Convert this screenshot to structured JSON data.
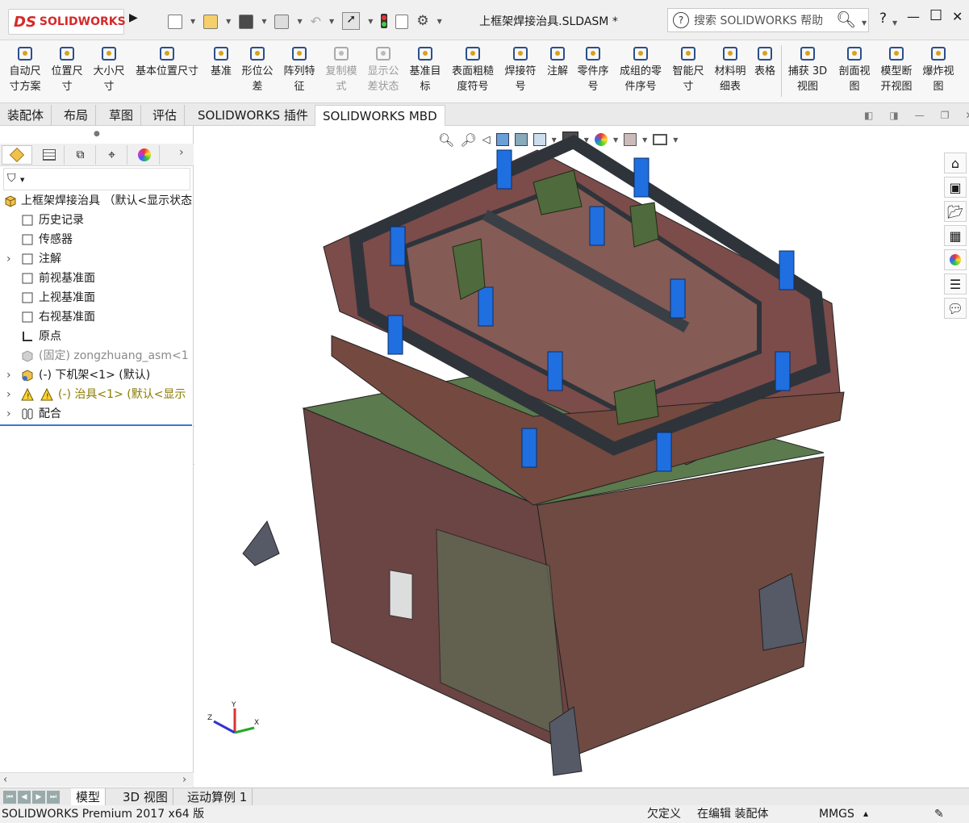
{
  "app": {
    "logo_text": "SOLIDWORKS",
    "logo_mark": "DS"
  },
  "title": "上框架焊接治具.SLDASM *",
  "search": {
    "placeholder": "搜索 SOLIDWORKS 帮助",
    "icon": "help-question-icon"
  },
  "window_controls": {
    "help": "?",
    "minimize": "—",
    "maximize": "☐",
    "close": "✕"
  },
  "ribbon": {
    "buttons": [
      {
        "label": "自动尺\n寸方案",
        "icon": "auto-dimension-icon",
        "disabled": false
      },
      {
        "label": "位置尺\n寸",
        "icon": "location-dimension-icon",
        "disabled": false
      },
      {
        "label": "大小尺\n寸",
        "icon": "size-dimension-icon",
        "disabled": false
      },
      {
        "label": "基本位置尺寸",
        "icon": "basic-location-dimension-icon",
        "disabled": false
      },
      {
        "label": "基准",
        "icon": "datum-icon",
        "disabled": false
      },
      {
        "label": "形位公\n差",
        "icon": "geometric-tolerance-icon",
        "disabled": false
      },
      {
        "label": "阵列特\n征",
        "icon": "pattern-feature-icon",
        "disabled": false
      },
      {
        "label": "复制模\n式",
        "icon": "copy-scheme-icon",
        "disabled": true
      },
      {
        "label": "显示公\n差状态",
        "icon": "show-tolerance-status-icon",
        "disabled": true
      },
      {
        "label": "基准目\n标",
        "icon": "datum-target-icon",
        "disabled": false
      },
      {
        "label": "表面粗糙\n度符号",
        "icon": "surface-finish-icon",
        "disabled": false
      },
      {
        "label": "焊接符\n号",
        "icon": "weld-symbol-icon",
        "disabled": false
      },
      {
        "label": "注解",
        "icon": "note-icon",
        "disabled": false
      },
      {
        "label": "零件序\n号",
        "icon": "balloon-icon",
        "disabled": false
      },
      {
        "label": "成组的零\n件序号",
        "icon": "stacked-balloon-icon",
        "disabled": false
      },
      {
        "label": "智能尺\n寸",
        "icon": "smart-dimension-icon",
        "disabled": false
      },
      {
        "label": "材料明\n细表",
        "icon": "bom-icon",
        "disabled": false
      },
      {
        "label": "表格",
        "icon": "table-icon",
        "disabled": false
      },
      {
        "label": "捕获 3D\n视图",
        "icon": "capture-3d-view-icon",
        "disabled": false
      },
      {
        "label": "剖面视\n图",
        "icon": "section-view-icon",
        "disabled": false
      },
      {
        "label": "模型断\n开视图",
        "icon": "broken-view-icon",
        "disabled": false
      },
      {
        "label": "爆炸视\n图",
        "icon": "exploded-view-icon",
        "disabled": false
      }
    ]
  },
  "command_tabs": [
    "装配体",
    "布局",
    "草图",
    "评估",
    "SOLIDWORKS 插件",
    "SOLIDWORKS MBD"
  ],
  "active_command_tab": "SOLIDWORKS MBD",
  "tree": {
    "root": "上框架焊接治具 （默认<显示状态",
    "items": [
      {
        "label": "历史记录",
        "icon": "history-icon",
        "expandable": false
      },
      {
        "label": "传感器",
        "icon": "sensor-icon",
        "expandable": false
      },
      {
        "label": "注解",
        "icon": "annotations-icon",
        "expandable": true
      },
      {
        "label": "前视基准面",
        "icon": "plane-icon",
        "expandable": false
      },
      {
        "label": "上视基准面",
        "icon": "plane-icon",
        "expandable": false
      },
      {
        "label": "右视基准面",
        "icon": "plane-icon",
        "expandable": false
      },
      {
        "label": "原点",
        "icon": "origin-icon",
        "expandable": false
      },
      {
        "label": "(固定) zongzhuang_asm<1",
        "icon": "part-icon",
        "expandable": false,
        "muted": true
      },
      {
        "label": "(-) 下机架<1> (默认)",
        "icon": "subassembly-icon",
        "expandable": true
      },
      {
        "label": "(-) 治具<1> (默认<显示",
        "icon": "warning-icon",
        "expandable": true,
        "warning": true
      },
      {
        "label": "配合",
        "icon": "mates-icon",
        "expandable": true
      }
    ]
  },
  "bottom_tabs": [
    "模型",
    "3D 视图",
    "运动算例 1"
  ],
  "active_bottom_tab": "模型",
  "status": {
    "version": "SOLIDWORKS Premium 2017 x64 版",
    "definition": "欠定义",
    "mode": "在编辑 装配体",
    "units": "MMGS"
  },
  "colors": {
    "blue_part": "#1f6fe0",
    "frame": "#3a3f46",
    "plate": "#7b4c4a",
    "base_top": "#5b7a4e",
    "brand": "#d42b2b"
  }
}
